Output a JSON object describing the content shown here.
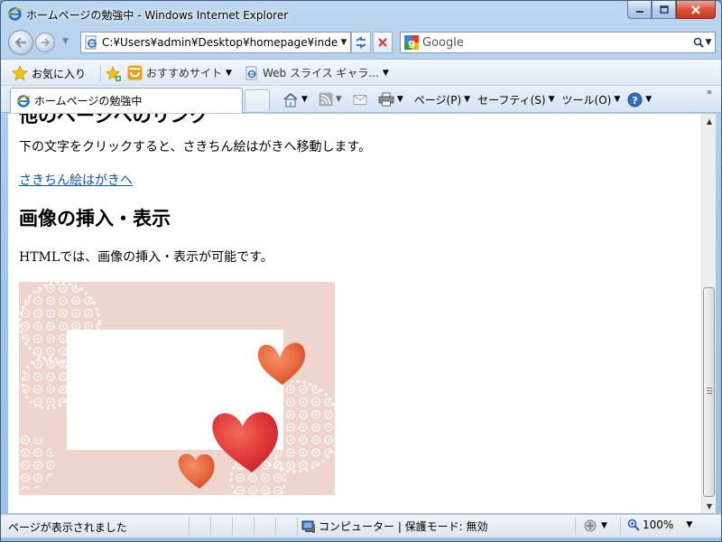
{
  "window": {
    "title": "ホームページの勉強中 - Windows Internet Explorer"
  },
  "address": {
    "url": "C:¥Users¥admin¥Desktop¥homepage¥inde"
  },
  "search": {
    "provider": "Google"
  },
  "favorites": {
    "favorites_label": "お気に入り",
    "suggested_sites": "おすすめサイト",
    "web_slice": "Web スライス ギャラ..."
  },
  "tab": {
    "label": "ホームページの勉強中"
  },
  "commands": {
    "page": "ページ(P)",
    "safety": "セーフティ(S)",
    "tools": "ツール(O)"
  },
  "content": {
    "cut_heading": "他のページへのリンク",
    "paragraph1": "下の文字をクリックすると、さきちん絵はがきへ移動します。",
    "link_text": "さきちん絵はがきへ",
    "heading2": "画像の挿入・表示",
    "paragraph2": "HTMLでは、画像の挿入・表示が可能です。"
  },
  "status": {
    "text": "ページが表示されました",
    "zone": "コンピューター | 保護モード: 無効",
    "zoom": "100%"
  },
  "icons": {
    "back": "back-arrow-icon",
    "forward": "forward-arrow-icon",
    "refresh": "refresh-icon",
    "stop": "stop-icon",
    "search": "magnifier-icon",
    "home": "home-icon",
    "feeds": "rss-icon",
    "mail": "mail-icon",
    "print": "printer-icon",
    "help": "help-icon"
  },
  "colors": {
    "link": "#1155aa",
    "heart": "#e03a3a",
    "postcard_bg": "#ecd0c8"
  }
}
